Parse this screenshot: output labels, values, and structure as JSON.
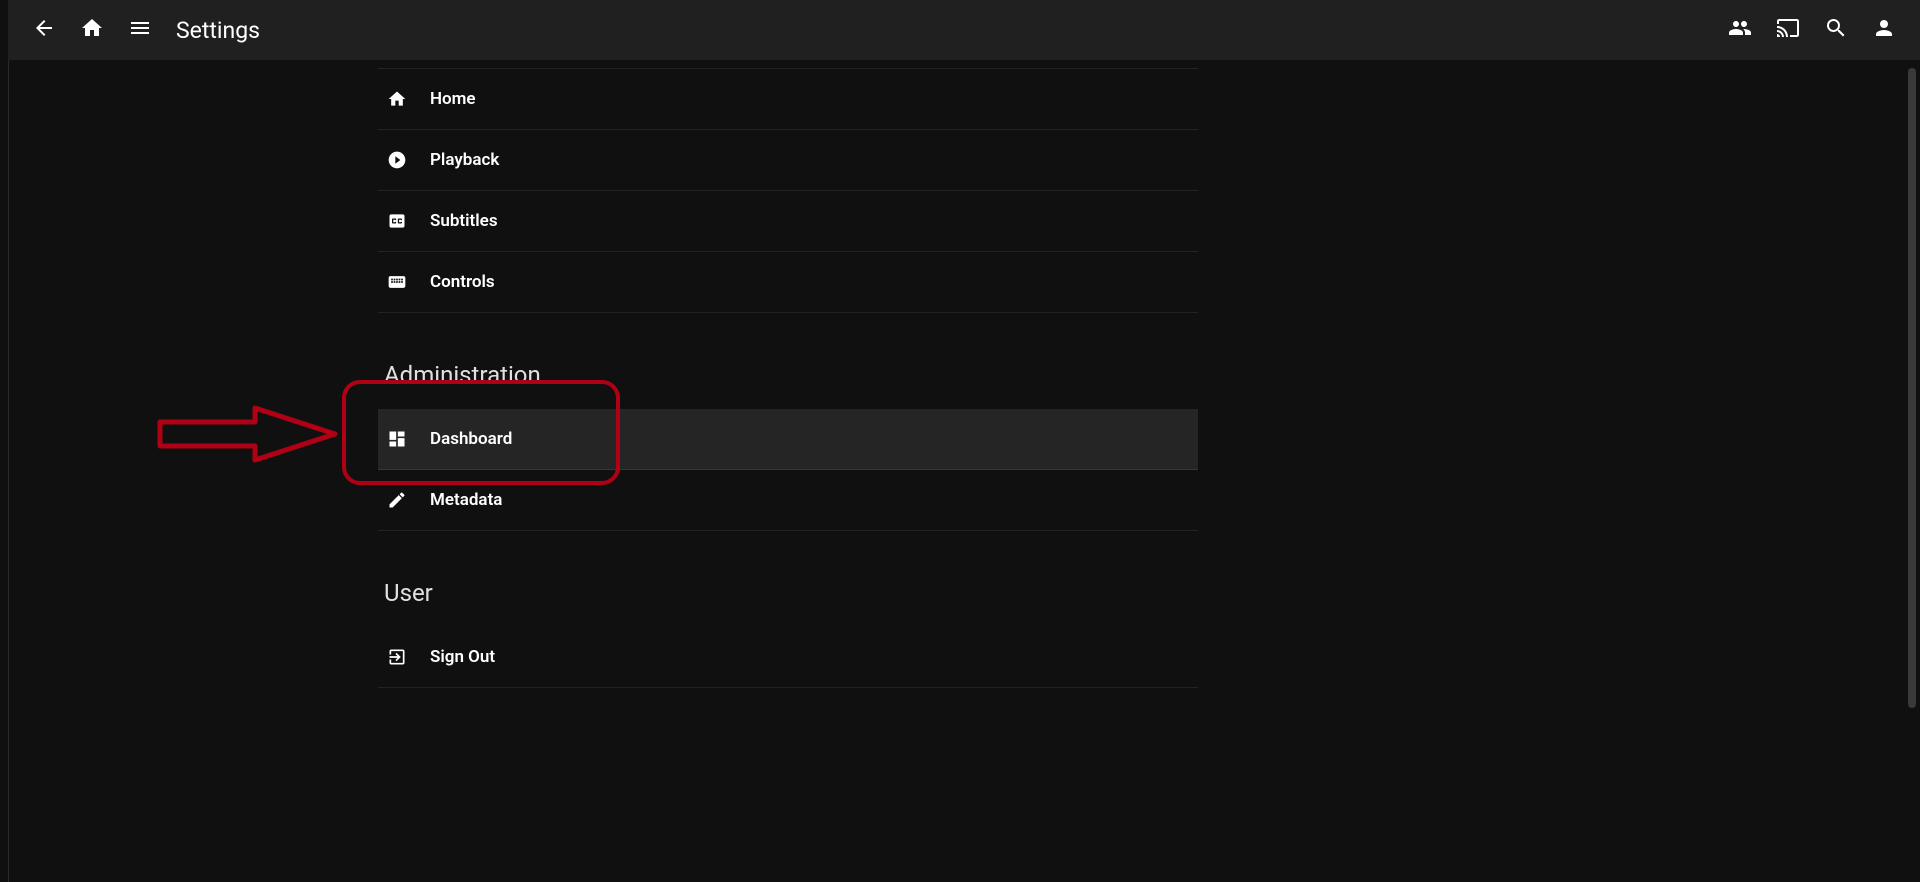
{
  "header": {
    "title": "Settings"
  },
  "sections": {
    "main_items": [
      {
        "label": "Home",
        "icon": "home"
      },
      {
        "label": "Playback",
        "icon": "play-circle"
      },
      {
        "label": "Subtitles",
        "icon": "closed-caption"
      },
      {
        "label": "Controls",
        "icon": "keyboard"
      }
    ],
    "administration": {
      "title": "Administration",
      "items": [
        {
          "label": "Dashboard",
          "icon": "dashboard",
          "highlighted": true
        },
        {
          "label": "Metadata",
          "icon": "edit"
        }
      ]
    },
    "user": {
      "title": "User",
      "items": [
        {
          "label": "Sign Out",
          "icon": "exit"
        }
      ]
    }
  },
  "annotation": {
    "arrow_color": "#b00015",
    "highlight_target": "Dashboard"
  }
}
